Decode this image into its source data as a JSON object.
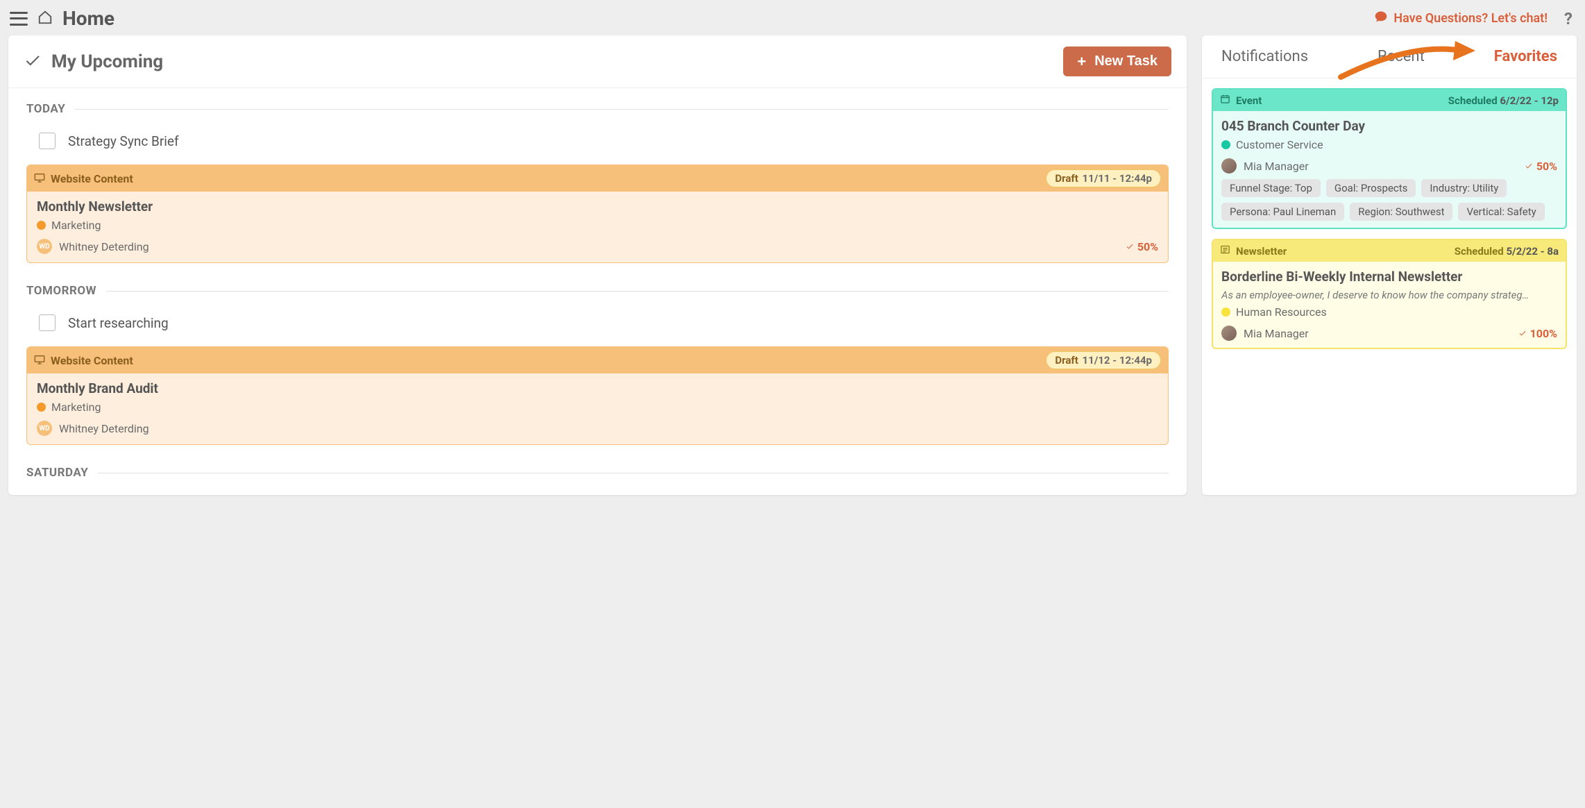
{
  "header": {
    "title": "Home",
    "chat_label": "Have Questions? Let's chat!",
    "help_label": "?"
  },
  "upcoming": {
    "title": "My Upcoming",
    "new_task_label": "New Task",
    "sections": [
      {
        "label": "TODAY",
        "task": "Strategy Sync Brief",
        "card": {
          "type_label": "Website Content",
          "status": "Draft",
          "datetime": "11/11 - 12:44p",
          "title": "Monthly Newsletter",
          "category": "Marketing",
          "assignee_initials": "WD",
          "assignee": "Whitney Deterding",
          "progress": "50%"
        }
      },
      {
        "label": "TOMORROW",
        "task": "Start researching",
        "card": {
          "type_label": "Website Content",
          "status": "Draft",
          "datetime": "11/12 - 12:44p",
          "title": "Monthly Brand Audit",
          "category": "Marketing",
          "assignee_initials": "WD",
          "assignee": "Whitney Deterding",
          "progress": ""
        }
      },
      {
        "label": "SATURDAY"
      }
    ]
  },
  "right": {
    "tabs": {
      "notifications": "Notifications",
      "recent": "Recent",
      "favorites": "Favorites"
    },
    "favorites": [
      {
        "type_label": "Event",
        "sched_label": "Scheduled",
        "datetime": "6/2/22 - 12p",
        "title": "045 Branch Counter Day",
        "category": "Customer Service",
        "assignee": "Mia Manager",
        "progress": "50%",
        "tags": [
          "Funnel Stage: Top",
          "Goal: Prospects",
          "Industry: Utility",
          "Persona: Paul Lineman",
          "Region: Southwest",
          "Vertical: Safety"
        ]
      },
      {
        "type_label": "Newsletter",
        "sched_label": "Scheduled",
        "datetime": "5/2/22 - 8a",
        "title": "Borderline Bi-Weekly Internal Newsletter",
        "subtitle": "As an employee-owner, I deserve to know how the company strateg…",
        "category": "Human Resources",
        "assignee": "Mia Manager",
        "progress": "100%"
      }
    ]
  }
}
